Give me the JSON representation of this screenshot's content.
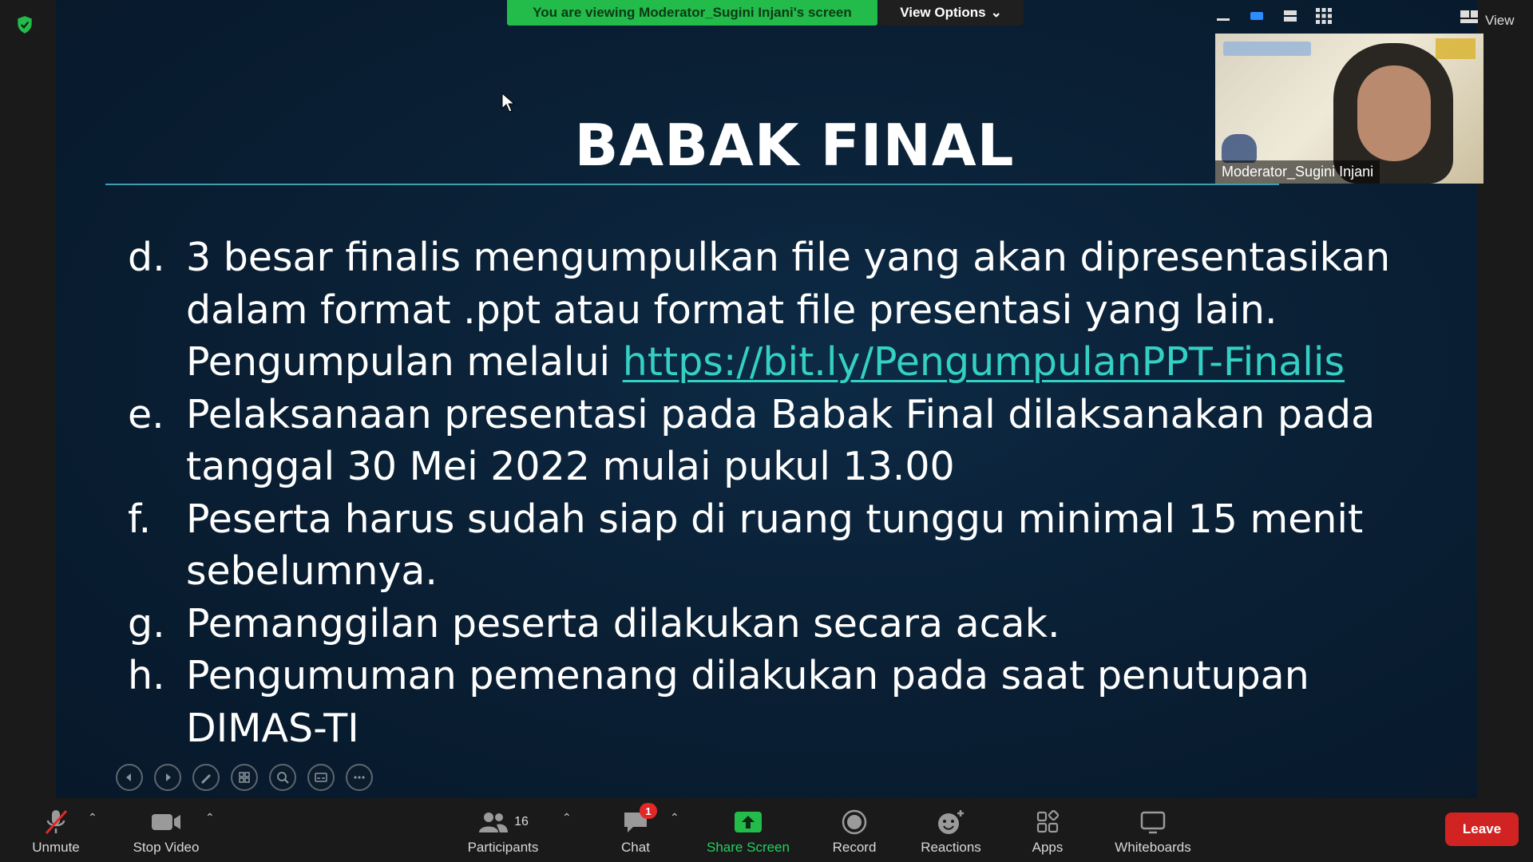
{
  "banner": {
    "share_text": "You are viewing Moderator_Sugini Injani's screen",
    "view_options": "View Options"
  },
  "slide": {
    "title": "BABAK FINAL",
    "items": [
      {
        "letter": "d.",
        "before_link": "3 besar finalis mengumpulkan file yang akan dipresentasikan dalam format .ppt atau format file presentasi yang lain. Pengumpulan melalui ",
        "link": "https://bit.ly/PengumpulanPPT-Finalis"
      },
      {
        "letter": "e.",
        "text": "Pelaksanaan presentasi pada Babak Final dilaksanakan pada tanggal 30 Mei 2022 mulai pukul 13.00"
      },
      {
        "letter": "f.",
        "text": "Peserta harus sudah siap di ruang tunggu minimal 15 menit sebelumnya."
      },
      {
        "letter": "g.",
        "text": "Pemanggilan peserta dilakukan secara acak."
      },
      {
        "letter": "h.",
        "text": "Pengumuman pemenang dilakukan pada saat penutupan DIMAS-TI"
      }
    ]
  },
  "video": {
    "participant_name": "Moderator_Sugini Injani"
  },
  "view_panel": {
    "label": "View"
  },
  "toolbar": {
    "unmute": "Unmute",
    "stop_video": "Stop Video",
    "participants": "Participants",
    "participants_count": "16",
    "chat": "Chat",
    "chat_badge": "1",
    "share_screen": "Share Screen",
    "record": "Record",
    "reactions": "Reactions",
    "apps": "Apps",
    "whiteboards": "Whiteboards",
    "leave": "Leave"
  },
  "colors": {
    "share_green": "#23bb4a",
    "link_teal": "#34d0c4",
    "leave_red": "#d22323"
  }
}
